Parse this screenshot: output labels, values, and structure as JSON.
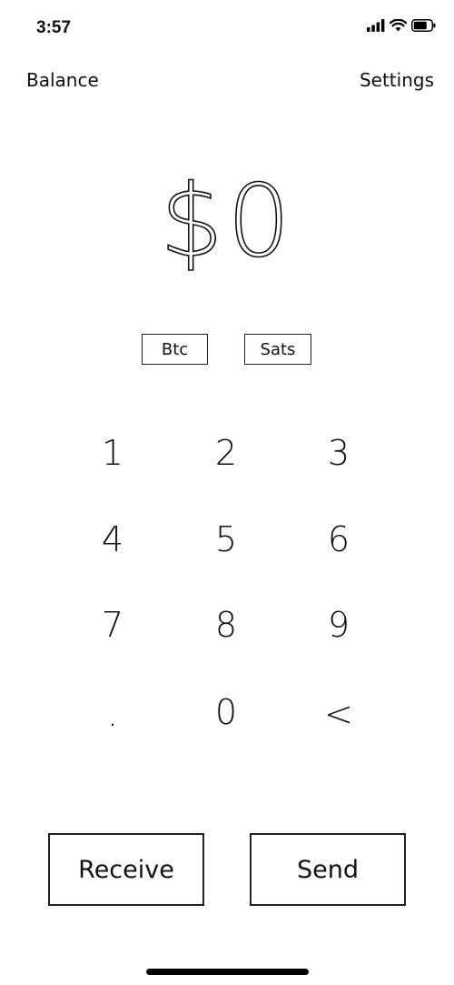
{
  "status_bar": {
    "time": "3:57",
    "icons": [
      "signal-icon",
      "wifi-icon",
      "battery-icon"
    ]
  },
  "nav": {
    "left_label": "Balance",
    "right_label": "Settings"
  },
  "amount": {
    "display": "$0"
  },
  "units": {
    "btc_label": "Btc",
    "sats_label": "Sats"
  },
  "keypad": {
    "keys": [
      "1",
      "2",
      "3",
      "4",
      "5",
      "6",
      "7",
      "8",
      "9",
      ".",
      "0",
      "<"
    ]
  },
  "actions": {
    "receive_label": "Receive",
    "send_label": "Send"
  },
  "colors": {
    "background": "#ffffff",
    "ink": "#111111"
  }
}
